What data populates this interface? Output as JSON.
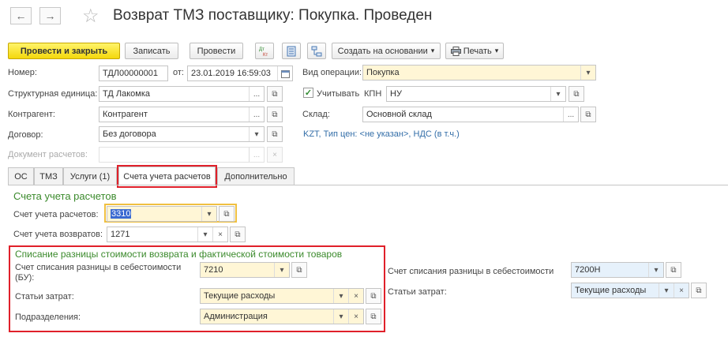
{
  "window": {
    "title": "Возврат ТМЗ поставщику: Покупка. Проведен"
  },
  "toolbar": {
    "post_close": "Провести и закрыть",
    "save": "Записать",
    "post": "Провести",
    "create_based": "Создать на основании",
    "print": "Печать"
  },
  "header": {
    "number_label": "Номер:",
    "number_value": "ТДЛ00000001",
    "date_label": "от:",
    "date_value": "23.01.2019 16:59:03",
    "operation_label": "Вид операции:",
    "operation_value": "Покупка",
    "unit_label": "Структурная единица:",
    "unit_value": "ТД Лакомка",
    "kpn_label": "Учитывать",
    "kpn_label2": "КПН",
    "kpn_value": "НУ",
    "counterparty_label": "Контрагент:",
    "counterparty_value": "Контрагент",
    "warehouse_label": "Склад:",
    "warehouse_value": "Основной склад",
    "contract_label": "Договор:",
    "contract_value": "Без договора",
    "price_info": "KZT, Тип цен: <не указан>, НДС (в т.ч.)",
    "settlement_doc_label": "Документ расчетов:"
  },
  "tabs": [
    "ОС",
    "ТМЗ",
    "Услуги (1)",
    "Счета учета расчетов",
    "Дополнительно"
  ],
  "accounts": {
    "section_title": "Счета учета расчетов",
    "settlement_label": "Счет учета расчетов:",
    "settlement_value": "3310",
    "returns_label": "Счет учета возвратов:",
    "returns_value": "1271"
  },
  "writeoff": {
    "section_title": "Списание разницы стоимости возврата и фактической стоимости товаров",
    "bu_label_line1": "Счет списания разницы в себестоимости",
    "bu_label_line2": "(БУ):",
    "bu_value": "7210",
    "expenses_label": "Статьи затрат:",
    "expenses_value": "Текущие расходы",
    "dept_label": "Подразделения:",
    "dept_value": "Администрация",
    "nu_label": "Счет списания разницы в себестоимости",
    "nu_value": "7200Н",
    "nu_expenses_label": "Статьи затрат:",
    "nu_expenses_value": "Текущие расходы"
  },
  "icons": {
    "back": "←",
    "forward": "→",
    "star": "☆",
    "dropdown": "▾",
    "more": "...",
    "open": "⧉",
    "clear": "×",
    "check": "✓"
  },
  "colors": {
    "primary_button": "#f4d80c",
    "highlight_red": "#e0202a",
    "section_green": "#3b8a2c",
    "link_blue": "#336ea8"
  }
}
